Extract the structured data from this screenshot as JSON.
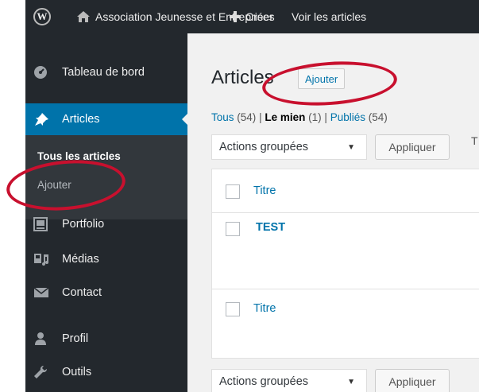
{
  "adminbar": {
    "wp_logo": "W",
    "site_name": "Association Jeunesse et Entreprises",
    "create_label": "Créer",
    "view_label": "Voir les articles",
    "icons": [
      "wordpress-icon",
      "home-icon",
      "plus-icon"
    ]
  },
  "sidebar": {
    "items": [
      {
        "label": "Tableau de bord",
        "icon": "dashboard-icon"
      },
      {
        "label": "Articles",
        "icon": "pin-icon",
        "active": true
      },
      {
        "label": "Portfolio",
        "icon": "portfolio-icon"
      },
      {
        "label": "Médias",
        "icon": "media-icon"
      },
      {
        "label": "Contact",
        "icon": "mail-icon"
      },
      {
        "label": "Profil",
        "icon": "user-icon"
      },
      {
        "label": "Outils",
        "icon": "wrench-icon"
      }
    ],
    "submenu": {
      "all_posts": "Tous les articles",
      "add_new": "Ajouter"
    }
  },
  "main": {
    "title": "Articles",
    "add_new_button": "Ajouter",
    "filters": {
      "all": "Tous",
      "all_count": "(54)",
      "mine": "Le mien",
      "mine_count": "(1)",
      "published": "Publiés",
      "published_count": "(54)",
      "separator": "|"
    },
    "bulk_actions": "Actions groupées",
    "apply_button": "Appliquer",
    "clipped_text": "T",
    "table": {
      "header_title": "Titre",
      "rows": [
        {
          "title": "TEST"
        }
      ],
      "footer_title": "Titre"
    }
  },
  "annotations": {
    "color": "#c8102e"
  },
  "colors": {
    "adminbar": "#23282d",
    "active": "#0073aa",
    "link": "#0073aa",
    "submenu": "#32373c"
  }
}
